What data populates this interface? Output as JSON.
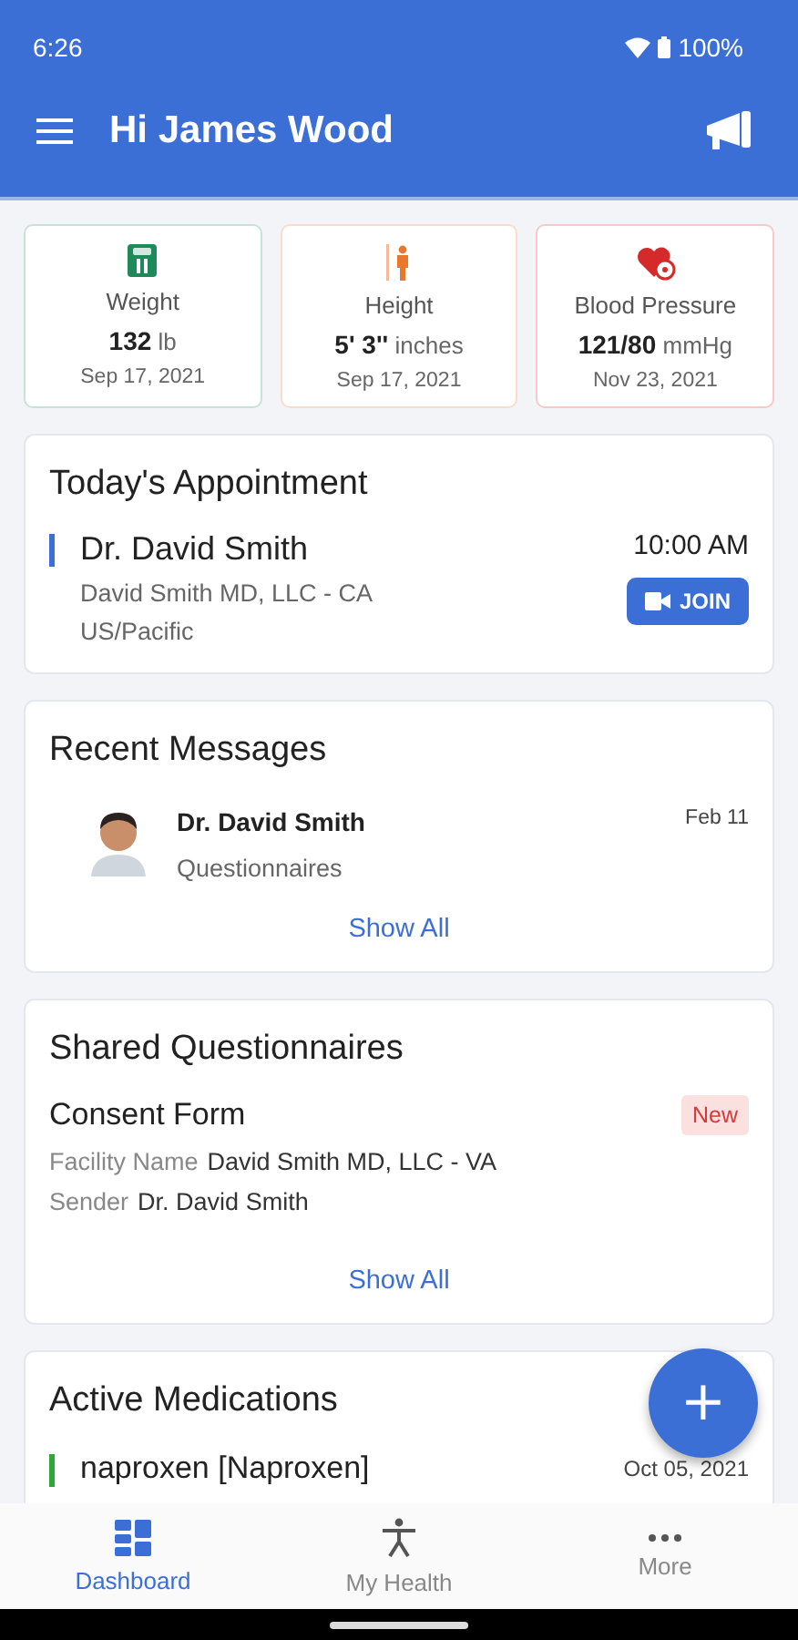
{
  "status_bar": {
    "time": "6:26",
    "battery": "100%"
  },
  "app_bar": {
    "title": "Hi James Wood"
  },
  "vitals": [
    {
      "kind": "weight",
      "label": "Weight",
      "value": "132",
      "unit": "lb",
      "date": "Sep 17, 2021",
      "color": "#1e8a5a"
    },
    {
      "kind": "height",
      "label": "Height",
      "value": "5' 3''",
      "unit": "inches",
      "date": "Sep 17, 2021",
      "color": "#e8782e"
    },
    {
      "kind": "pressure",
      "label": "Blood Pressure",
      "value": "121/80",
      "unit": "mmHg",
      "date": "Nov 23, 2021",
      "color": "#d42a2a"
    }
  ],
  "appointment": {
    "title": "Today's Appointment",
    "doctor": "Dr. David Smith",
    "facility": "David Smith MD, LLC - CA",
    "timezone": "US/Pacific",
    "time": "10:00 AM",
    "join": "JOIN"
  },
  "messages": {
    "title": "Recent Messages",
    "items": [
      {
        "sender": "Dr. David Smith",
        "subject": "Questionnaires",
        "date": "Feb 11"
      }
    ],
    "show_all": "Show All"
  },
  "questionnaires": {
    "title": "Shared Questionnaires",
    "items": [
      {
        "name": "Consent Form",
        "badge": "New",
        "facility_label": "Facility Name",
        "facility": "David Smith MD, LLC - VA",
        "sender_label": "Sender",
        "sender": "Dr. David Smith"
      }
    ],
    "show_all": "Show All"
  },
  "medications": {
    "title": "Active Medications",
    "items": [
      {
        "name": "naproxen [Naproxen]",
        "date": "Oct 05, 2021"
      }
    ]
  },
  "fab": {
    "label": "+"
  },
  "nav": [
    {
      "kind": "dashboard",
      "label": "Dashboard",
      "selected": true
    },
    {
      "kind": "health",
      "label": "My Health",
      "selected": false
    },
    {
      "kind": "more",
      "label": "More",
      "selected": false
    }
  ]
}
